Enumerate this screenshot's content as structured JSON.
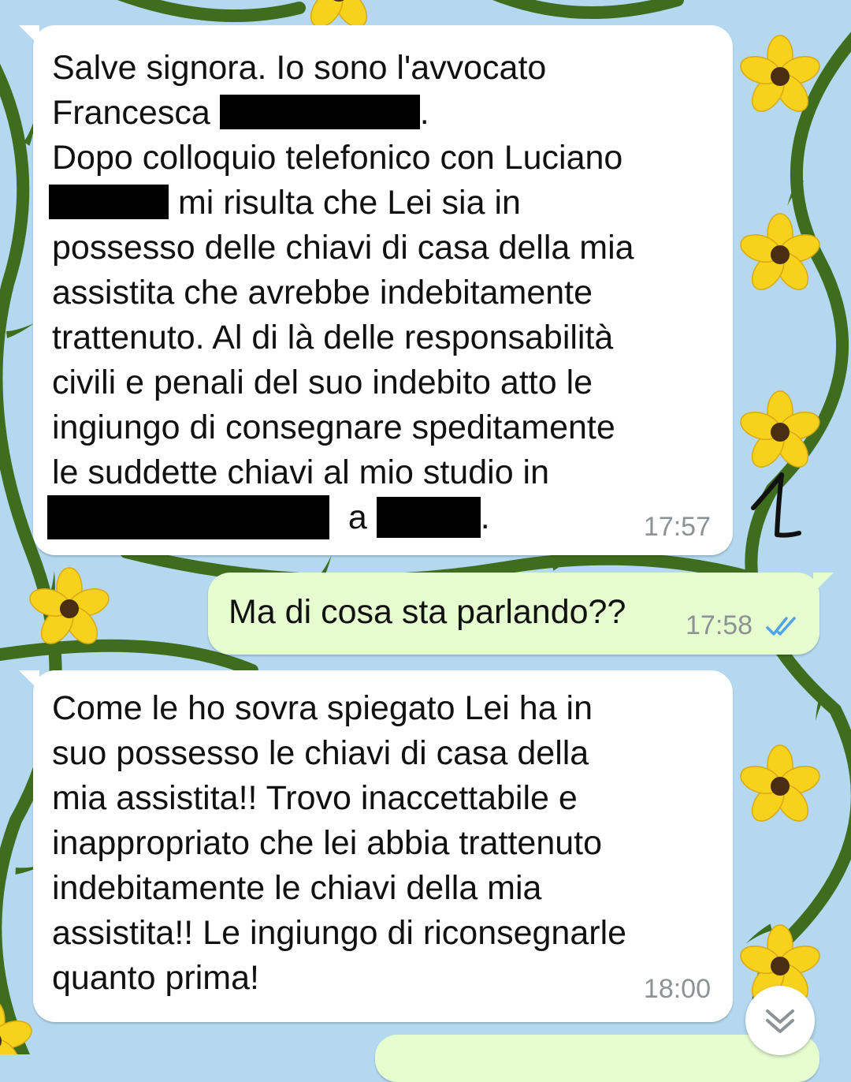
{
  "chat": {
    "messages": [
      {
        "direction": "incoming",
        "lines": [
          "Salve signora. Io sono l'avvocato",
          "Francesca",
          "Dopo colloquio telefonico con Luciano",
          "mi risulta che Lei sia in",
          "possesso delle chiavi di casa della mia",
          "assistita che avrebbe indebitamente",
          "trattenuto. Al di là delle responsabilità",
          "civili e penali del suo indebito atto le",
          "ingiungo di consegnare speditamente",
          "le suddette chiavi al mio studio in",
          "a"
        ],
        "time": "17:57"
      },
      {
        "direction": "outgoing",
        "text": "Ma di cosa sta parlando??",
        "time": "17:58",
        "status": "read",
        "status_icon": "double-check-icon",
        "status_color": "#4fa3e8"
      },
      {
        "direction": "incoming",
        "lines": [
          "Come le ho sovra spiegato Lei ha in",
          "suo possesso le chiavi di casa della",
          "mia assistita!! Trovo inaccettabile e",
          "inappropriato che lei abbia trattenuto",
          "indebitamente le chiavi della mia",
          "assistita!! Le ingiungo di riconsegnarle",
          "quanto prima!"
        ],
        "time": "18:00"
      }
    ],
    "annotation": "1",
    "scroll_button_icon": "chevron-double-down-icon"
  },
  "colors": {
    "wallpaper_bg": "#b3d8ef",
    "incoming_bubble": "#ffffff",
    "outgoing_bubble": "#e6fdd0",
    "flower_petal": "#f7d21c",
    "flower_center": "#4a2e14",
    "vine": "#3f6d1e",
    "read_ticks": "#4fa3e8"
  }
}
